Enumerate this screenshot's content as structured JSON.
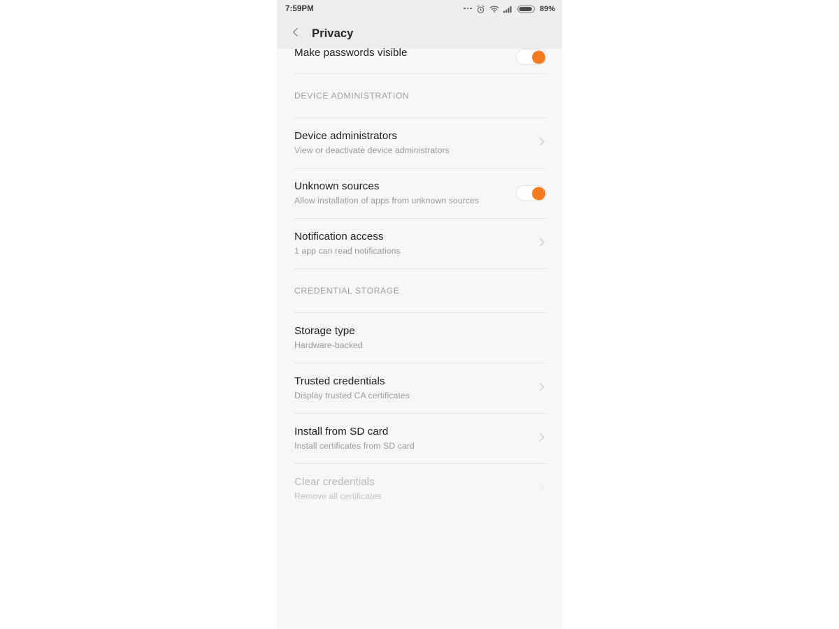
{
  "status_bar": {
    "time": "7:59PM",
    "battery_percent": "89%",
    "icons": [
      "more-dots-icon",
      "alarm-icon",
      "wifi-icon",
      "signal-icon",
      "battery-icon"
    ]
  },
  "app_bar": {
    "back_icon": "chevron-left-icon",
    "title": "Privacy"
  },
  "colors": {
    "accent": "#f47b20",
    "screen_background": "#f7f7f7",
    "appbar_background": "#ededed",
    "title_text": "#1f1f1f",
    "subtitle_text": "#9a9a9a",
    "disabled_text": "#b9b9b9",
    "divider": "#e6e6e6"
  },
  "list": {
    "clipped_top_row": {
      "title": "Make passwords visible",
      "control": "toggle",
      "toggle_state": "on"
    },
    "sections": [
      {
        "header": "DEVICE ADMINISTRATION",
        "items": [
          {
            "title": "Device administrators",
            "subtitle": "View or deactivate device administrators",
            "control": "chevron",
            "enabled": true
          },
          {
            "title": "Unknown sources",
            "subtitle": "Allow installation of apps from unknown sources",
            "control": "toggle",
            "toggle_state": "on",
            "enabled": true
          },
          {
            "title": "Notification access",
            "subtitle": "1 app can read notifications",
            "control": "chevron",
            "enabled": true
          }
        ]
      },
      {
        "header": "CREDENTIAL STORAGE",
        "items": [
          {
            "title": "Storage type",
            "subtitle": "Hardware-backed",
            "control": "none",
            "enabled": true
          },
          {
            "title": "Trusted credentials",
            "subtitle": "Display trusted CA certificates",
            "control": "chevron",
            "enabled": true
          },
          {
            "title": "Install from SD card",
            "subtitle": "Install certificates from SD card",
            "control": "chevron",
            "enabled": true
          },
          {
            "title": "Clear credentials",
            "subtitle": "Remove all certificates",
            "control": "chevron",
            "enabled": false
          }
        ]
      }
    ]
  }
}
